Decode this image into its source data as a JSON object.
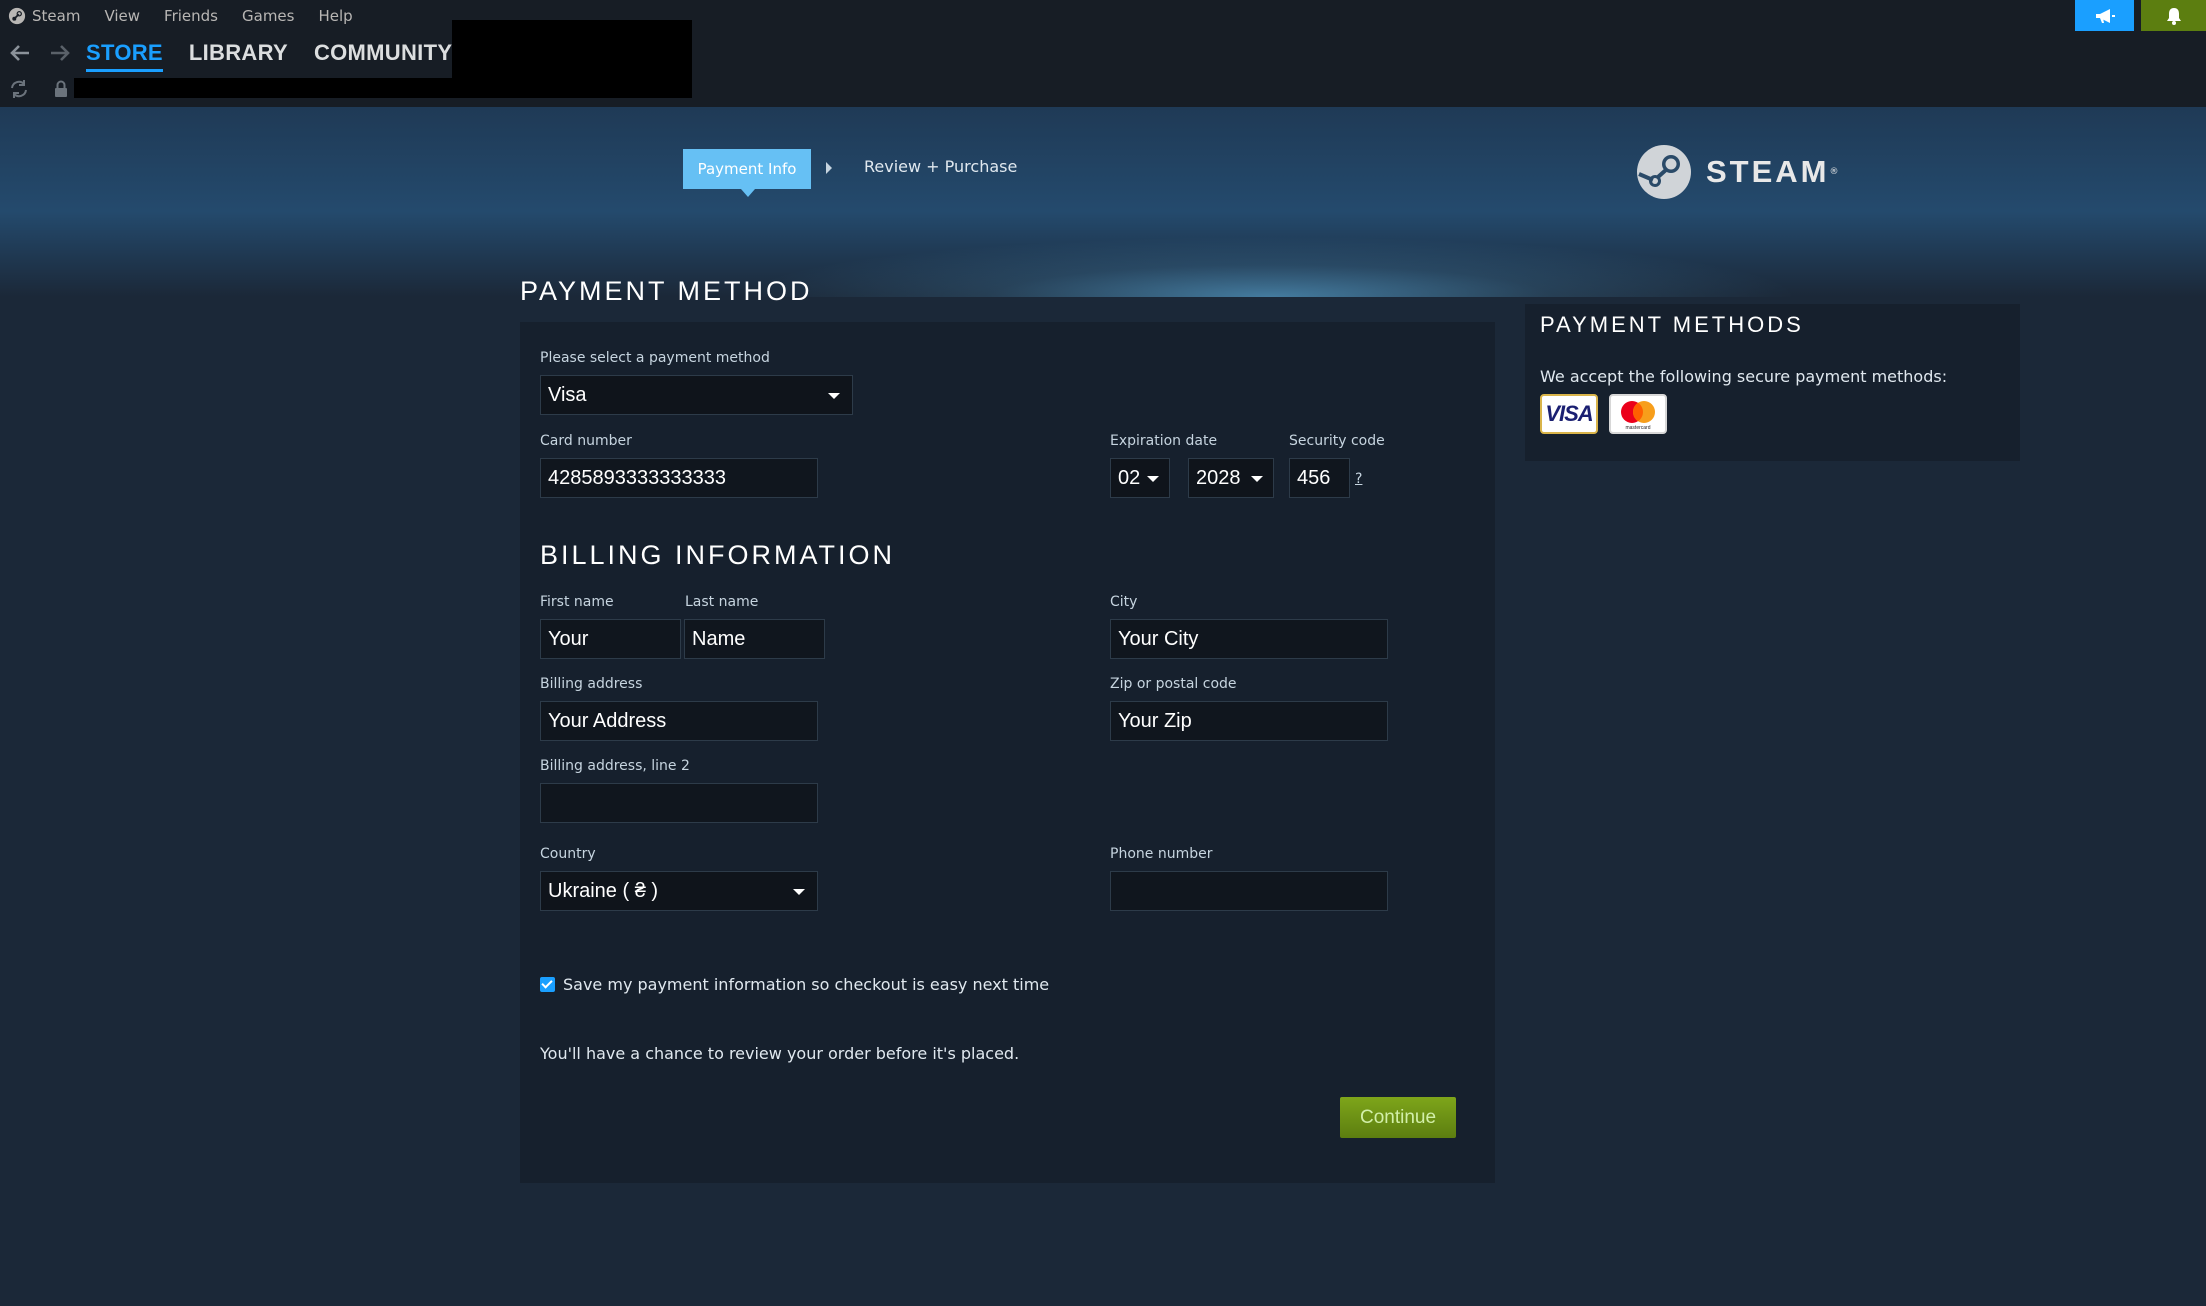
{
  "menubar": {
    "items": [
      "Steam",
      "View",
      "Friends",
      "Games",
      "Help"
    ]
  },
  "nav": {
    "tabs": [
      "STORE",
      "LIBRARY",
      "COMMUNITY"
    ],
    "active": "STORE"
  },
  "breadcrumb": {
    "step1": "Payment Info",
    "step2": "Review + Purchase"
  },
  "brand": {
    "wordmark": "STEAM",
    "reg": "®"
  },
  "payment": {
    "title": "PAYMENT METHOD",
    "select_label": "Please select a payment method",
    "method": "Visa",
    "card_label": "Card number",
    "card_number": "4285893333333333",
    "exp_label": "Expiration date",
    "exp_month": "02",
    "exp_year": "2028",
    "sec_label": "Security code",
    "sec_code": "456",
    "sec_help": "?"
  },
  "billing": {
    "title": "BILLING INFORMATION",
    "first_label": "First name",
    "first": "Your",
    "last_label": "Last name",
    "last": "Name",
    "city_label": "City",
    "city": "Your City",
    "addr_label": "Billing address",
    "addr": "Your Address",
    "zip_label": "Zip or postal code",
    "zip": "Your Zip",
    "addr2_label": "Billing address, line 2",
    "addr2": "",
    "country_label": "Country",
    "country": "Ukraine ( ₴ )",
    "phone_label": "Phone number",
    "phone": ""
  },
  "save": {
    "checked": true,
    "label": "Save my payment information so checkout is easy next time"
  },
  "review_note": "You'll have a chance to review your order before it's placed.",
  "continue_label": "Continue",
  "side": {
    "title": "PAYMENT METHODS",
    "text": "We accept the following secure payment methods:",
    "cards": [
      "VISA",
      "mastercard"
    ]
  },
  "colors": {
    "accent_blue": "#1a9fff",
    "crumb_blue": "#66c0f4",
    "green": "#5c7e10",
    "bg": "#1b2838"
  }
}
